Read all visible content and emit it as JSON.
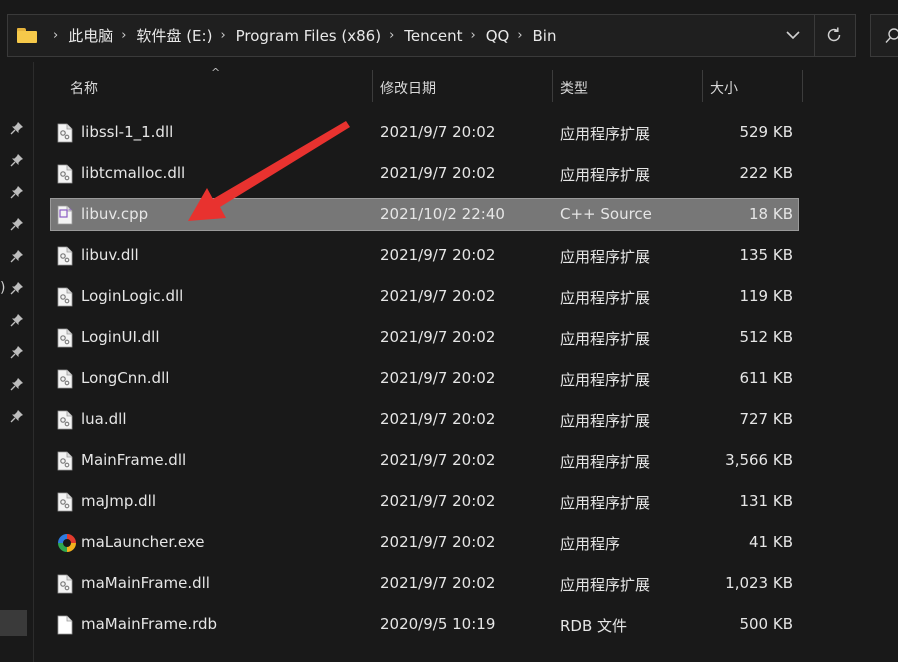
{
  "breadcrumb": {
    "items": [
      "此电脑",
      "软件盘 (E:)",
      "Program Files (x86)",
      "Tencent",
      "QQ",
      "Bin"
    ]
  },
  "columns": {
    "name": "名称",
    "modified": "修改日期",
    "type": "类型",
    "size": "大小"
  },
  "nav": {
    "partial_text": ")"
  },
  "files": [
    {
      "name": "libssl-1_1.dll",
      "modified": "2021/9/7 20:02",
      "type": "应用程序扩展",
      "size": "529 KB",
      "icon": "dll-file-icon",
      "selected": false
    },
    {
      "name": "libtcmalloc.dll",
      "modified": "2021/9/7 20:02",
      "type": "应用程序扩展",
      "size": "222 KB",
      "icon": "dll-file-icon",
      "selected": false
    },
    {
      "name": "libuv.cpp",
      "modified": "2021/10/2 22:40",
      "type": "C++ Source",
      "size": "18 KB",
      "icon": "cpp-file-icon",
      "selected": true
    },
    {
      "name": "libuv.dll",
      "modified": "2021/9/7 20:02",
      "type": "应用程序扩展",
      "size": "135 KB",
      "icon": "dll-file-icon",
      "selected": false
    },
    {
      "name": "LoginLogic.dll",
      "modified": "2021/9/7 20:02",
      "type": "应用程序扩展",
      "size": "119 KB",
      "icon": "dll-file-icon",
      "selected": false
    },
    {
      "name": "LoginUI.dll",
      "modified": "2021/9/7 20:02",
      "type": "应用程序扩展",
      "size": "512 KB",
      "icon": "dll-file-icon",
      "selected": false
    },
    {
      "name": "LongCnn.dll",
      "modified": "2021/9/7 20:02",
      "type": "应用程序扩展",
      "size": "611 KB",
      "icon": "dll-file-icon",
      "selected": false
    },
    {
      "name": "lua.dll",
      "modified": "2021/9/7 20:02",
      "type": "应用程序扩展",
      "size": "727 KB",
      "icon": "dll-file-icon",
      "selected": false
    },
    {
      "name": "MainFrame.dll",
      "modified": "2021/9/7 20:02",
      "type": "应用程序扩展",
      "size": "3,566 KB",
      "icon": "dll-file-icon",
      "selected": false
    },
    {
      "name": "maJmp.dll",
      "modified": "2021/9/7 20:02",
      "type": "应用程序扩展",
      "size": "131 KB",
      "icon": "dll-file-icon",
      "selected": false
    },
    {
      "name": "maLauncher.exe",
      "modified": "2021/9/7 20:02",
      "type": "应用程序",
      "size": "41 KB",
      "icon": "exe-app-icon",
      "selected": false
    },
    {
      "name": "maMainFrame.dll",
      "modified": "2021/9/7 20:02",
      "type": "应用程序扩展",
      "size": "1,023 KB",
      "icon": "dll-file-icon",
      "selected": false
    },
    {
      "name": "maMainFrame.rdb",
      "modified": "2020/9/5 10:19",
      "type": "RDB 文件",
      "size": "500 KB",
      "icon": "generic-file-icon",
      "selected": false
    }
  ],
  "colors": {
    "background": "#191919",
    "selected_row": "#777777",
    "annotation_arrow": "#e8322f",
    "folder": "#f6c94a"
  }
}
